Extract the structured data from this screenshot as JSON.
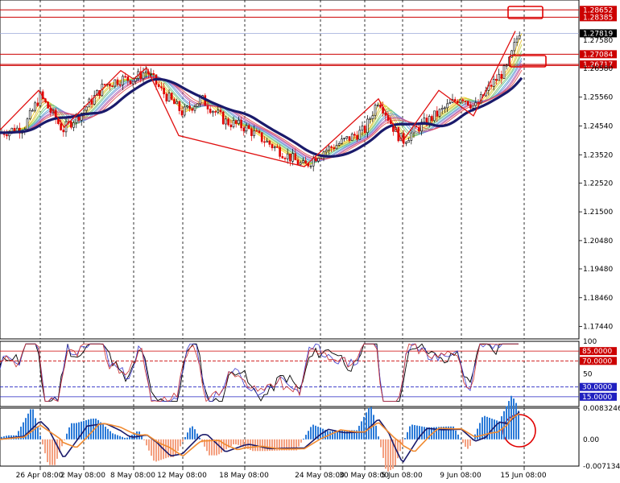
{
  "colors": {
    "background": "#ffffff",
    "grid": "#000000",
    "bull": "#000000",
    "bear": "#e00000",
    "zigzag": "#e01010",
    "ma_thick": "#1a1a6b",
    "level_line": "#cc0000",
    "current_line": "#9aa8d8",
    "highlight": "#e00000",
    "rsi_main": "#000000",
    "rsi_blue": "#3a3acc",
    "rsi_red": "#cc3030",
    "macd_pos": "#2a7ad8",
    "macd_neg": "#f4a080",
    "macd_line": "#1a1a6b",
    "signal_line": "#f08a30"
  },
  "price_axis": {
    "labels": [
      "1.25560",
      "1.24540",
      "1.23520",
      "1.22520",
      "1.21500",
      "1.20480",
      "1.19480",
      "1.18460",
      "1.17440"
    ],
    "ylim": [
      1.17,
      1.29
    ]
  },
  "levels": [
    {
      "label": "1.28652",
      "value": 1.2865
    },
    {
      "label": "1.28385",
      "value": 1.2839
    },
    {
      "label": "1.27819",
      "value": 1.2782,
      "current": true
    },
    {
      "label": "1.27580",
      "value": 1.2758,
      "plain": true
    },
    {
      "label": "1.27084",
      "value": 1.2708
    },
    {
      "label": "1.26717",
      "value": 1.2672
    },
    {
      "label": "1.26580",
      "value": 1.2658,
      "plain": true
    }
  ],
  "rsi": {
    "labels": [
      "100",
      "85.0000",
      "70.0000",
      "50",
      "30.0000",
      "15.0000"
    ],
    "levels": [
      100,
      85,
      70,
      50,
      30,
      15
    ]
  },
  "macd": {
    "labels": [
      "0.0083246",
      "0.00",
      "-0.0071348"
    ],
    "range": [
      -0.0071348,
      0.0083246
    ]
  },
  "time_axis": {
    "labels": [
      "26 Apr 08:00",
      "2 May 08:00",
      "8 May 08:00",
      "12 May 08:00",
      "18 May 08:00",
      "24 May 08:00",
      "30 May 08:00",
      "5 Jun 08:00",
      "9 Jun 08:00",
      "15 Jun 08:00"
    ]
  },
  "chart_data": {
    "type": "line",
    "title": "",
    "x": [
      "26 Apr 08:00",
      "2 May 08:00",
      "8 May 08:00",
      "12 May 08:00",
      "18 May 08:00",
      "24 May 08:00",
      "30 May 08:00",
      "5 Jun 08:00",
      "9 Jun 08:00",
      "15 Jun 08:00"
    ],
    "series": [
      {
        "values": [
          1.243,
          1.247,
          1.265,
          1.25,
          1.243,
          1.235,
          1.238,
          1.243,
          1.25,
          1.272
        ]
      }
    ],
    "zigzag": [
      1.244,
      1.258,
      1.245,
      1.265,
      1.262,
      1.266,
      1.242,
      1.231,
      1.255,
      1.24,
      1.258,
      1.249,
      1.279
    ],
    "ylim": [
      1.17,
      1.29
    ],
    "grid": true
  }
}
